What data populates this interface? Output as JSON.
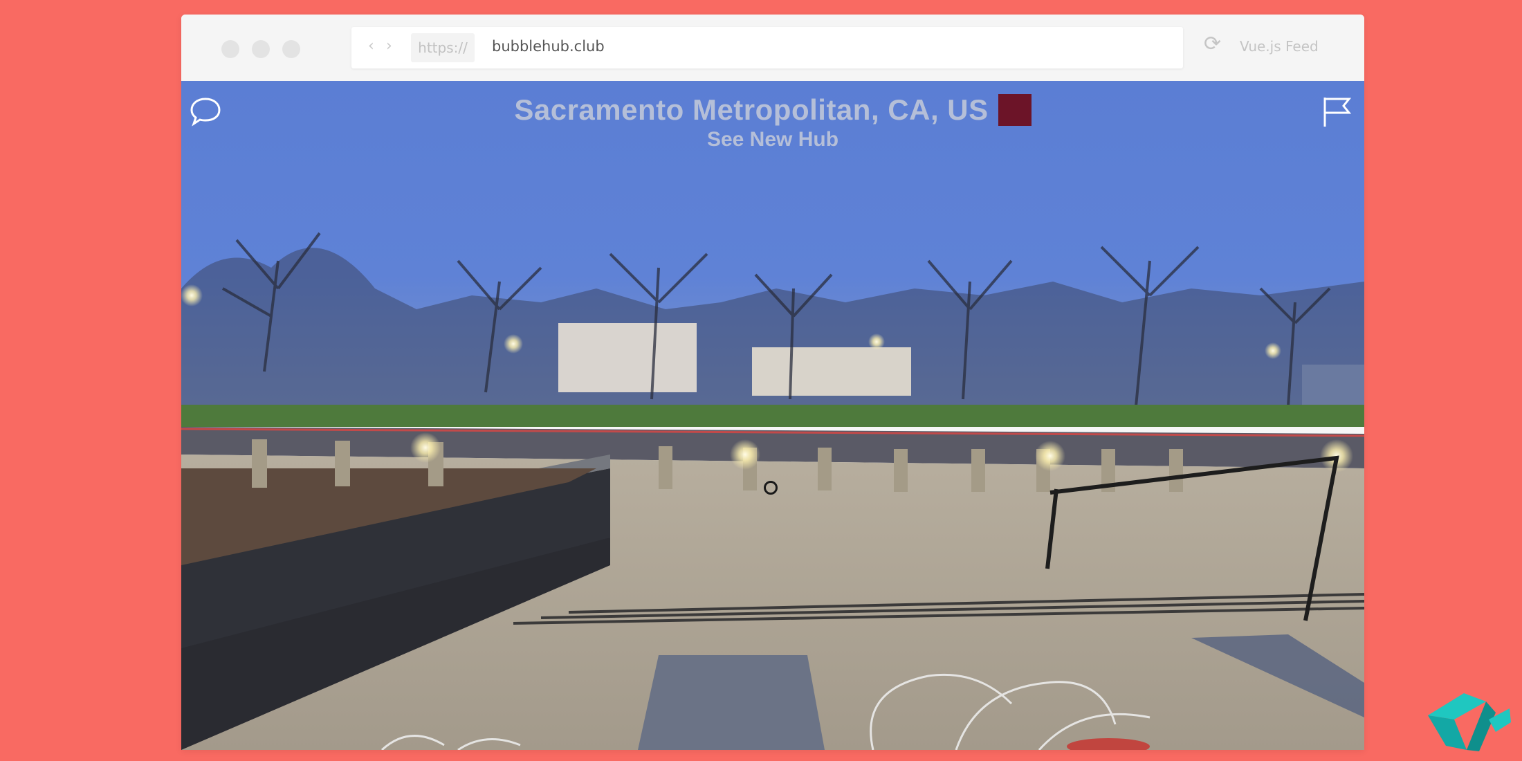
{
  "browser": {
    "scheme": "https://",
    "host": "bubblehub.club",
    "feed_label": "Vue.js Feed",
    "reload_icon": "reload-icon",
    "back_icon": "chevron-left-icon",
    "forward_icon": "chevron-right-icon"
  },
  "hub": {
    "title": "Sacramento Metropolitan, CA, US",
    "color_swatch": "#6c1428",
    "subtitle": "See New Hub"
  },
  "icons": {
    "chat": "chat-bubble-icon",
    "flag": "flag-icon",
    "logo": "vue-feed-logo"
  },
  "colors": {
    "background": "#f96a62",
    "title_text": "#b5bfd8",
    "logo_teal": "#18b4b0"
  }
}
